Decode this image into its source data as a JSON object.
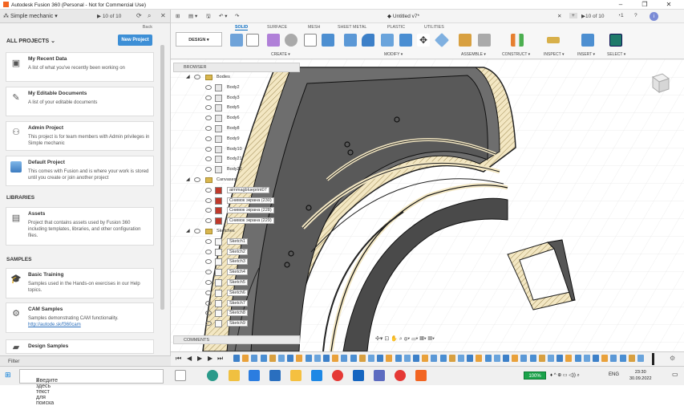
{
  "window": {
    "title": "Autodesk Fusion 360 (Personal - Not for Commercial Use)"
  },
  "data_panel": {
    "team": "Simple mechanic",
    "count": "10 of 10",
    "back": "Back",
    "projects_header": "ALL PROJECTS",
    "new_project": "New Project",
    "cards": [
      {
        "title": "My Recent Data",
        "desc": "A list of what you've recently been working on",
        "icon": "recent-icon"
      },
      {
        "title": "My Editable Documents",
        "desc": "A list of your editable documents",
        "icon": "edit-icon"
      },
      {
        "title": "Admin Project",
        "desc": "This project is for team members with Admin privileges in Simple mechanic",
        "icon": "admin-icon"
      },
      {
        "title": "Default Project",
        "desc": "This comes with Fusion and is where your work is stored until you create or join another project",
        "icon": "default-project-icon"
      }
    ],
    "libraries_header": "LIBRARIES",
    "assets": {
      "title": "Assets",
      "desc": "Project that contains assets used by Fusion 360 including templates, libraries, and other configuration files."
    },
    "samples_header": "SAMPLES",
    "samples": [
      {
        "title": "Basic Training",
        "desc": "Samples used in the Hands-on exercises in our Help topics."
      },
      {
        "title": "CAM Samples",
        "desc": "Samples demonstrating CAM functionality.",
        "link": "http://autode.sk/f360cam"
      },
      {
        "title": "Design Samples",
        "desc": ""
      }
    ],
    "filter": "Filter"
  },
  "tabbar": {
    "doc_title": "Untitled v7*",
    "count": "10 of 10",
    "notif": "1"
  },
  "ribbon": {
    "workspace": "DESIGN",
    "tabs": [
      "SOLID",
      "SURFACE",
      "MESH",
      "SHEET METAL",
      "PLASTIC",
      "UTILITIES"
    ],
    "groups": [
      "CREATE",
      "MODIFY",
      "ASSEMBLE",
      "CONSTRUCT",
      "INSPECT",
      "INSERT",
      "SELECT"
    ]
  },
  "browser": {
    "title": "BROWSER",
    "bodies_label": "Bodies",
    "bodies": [
      "Body2",
      "Body3",
      "Body5",
      "Body6",
      "Body8",
      "Body9",
      "Body10",
      "Body21",
      "Body22"
    ],
    "canvases_label": "Canvases",
    "canvases": [
      "aimmagblueprint07",
      "Снимок экрана (230)",
      "Снимок экрана (228)",
      "Снимок экрана (229)"
    ],
    "sketches_label": "Sketches",
    "sketches": [
      "Sketch1",
      "Sketch2",
      "Sketch3",
      "Sketch4",
      "Sketch5",
      "Sketch6",
      "Sketch7",
      "Sketch8",
      "Sketch9"
    ]
  },
  "comments": "COMMENTS",
  "taskbar": {
    "search_placeholder": "Введите здесь текст для поиска",
    "battery": "100%",
    "lang": "ENG",
    "time": "23:30",
    "date": "30.09.2022"
  }
}
